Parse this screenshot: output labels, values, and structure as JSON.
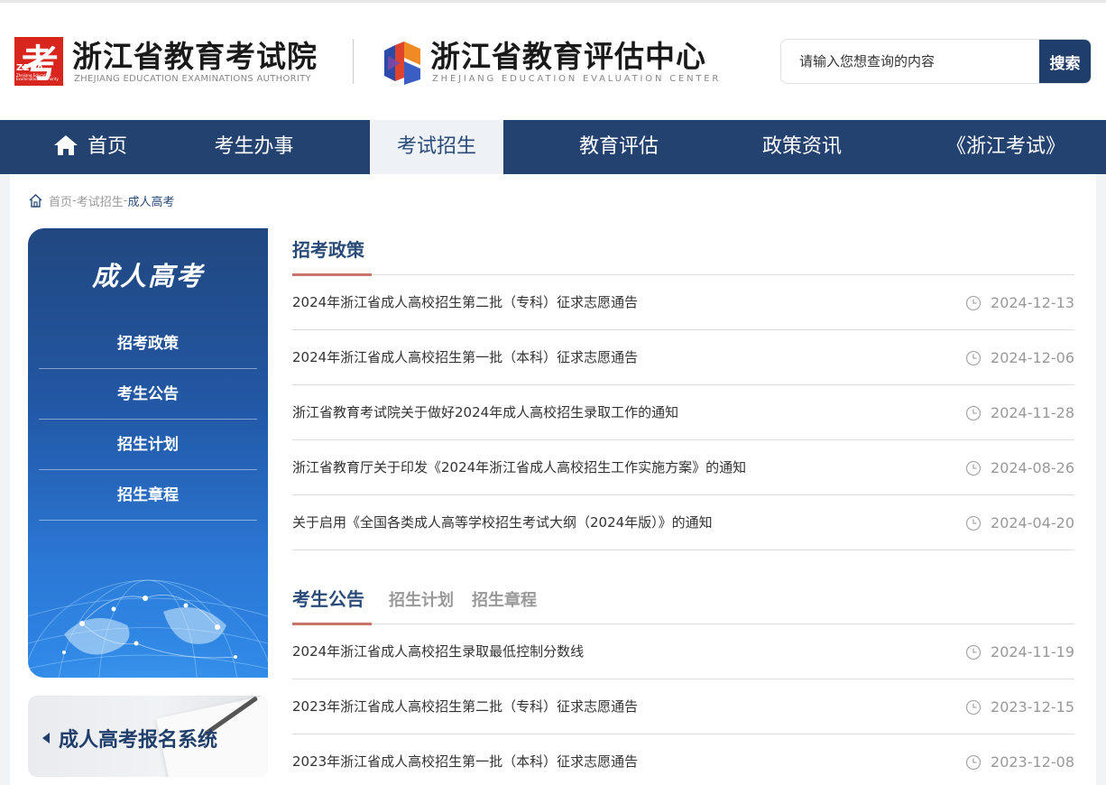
{
  "header": {
    "logo1_glyph": "考",
    "logo1_abbr": "ZEEA",
    "logo1_small": "Zhejiang Education Examinations Authority",
    "title1": "浙江省教育考试院",
    "subtitle1": "ZHEJIANG EDUCATION EXAMINATIONS AUTHORITY",
    "title2": "浙江省教育评估中心",
    "subtitle2": "ZHEJIANG EDUCATION EVALUATION CENTER"
  },
  "search": {
    "placeholder": "请输入您想查询的内容",
    "button_label": "搜索"
  },
  "nav": {
    "items": [
      {
        "label": "首页"
      },
      {
        "label": "考生办事"
      },
      {
        "label": "考试招生"
      },
      {
        "label": "教育评估"
      },
      {
        "label": "政策资讯"
      },
      {
        "label": "《浙江考试》"
      }
    ]
  },
  "breadcrumb": {
    "home": "首页",
    "sep1": "-",
    "level1": "考试招生",
    "sep2": "-",
    "current": "成人高考"
  },
  "sidebar": {
    "title": "成人高考",
    "items": [
      {
        "label": "招考政策"
      },
      {
        "label": "考生公告"
      },
      {
        "label": "招生计划"
      },
      {
        "label": "招生章程"
      }
    ]
  },
  "banner": {
    "label": "成人高考报名系统"
  },
  "section1": {
    "title": "招考政策",
    "items": [
      {
        "title": "2024年浙江省成人高校招生第二批（专科）征求志愿通告",
        "date": "2024-12-13"
      },
      {
        "title": "2024年浙江省成人高校招生第一批（本科）征求志愿通告",
        "date": "2024-12-06"
      },
      {
        "title": "浙江省教育考试院关于做好2024年成人高校招生录取工作的通知",
        "date": "2024-11-28"
      },
      {
        "title": "浙江省教育厅关于印发《2024年浙江省成人高校招生工作实施方案》的通知",
        "date": "2024-08-26"
      },
      {
        "title": "关于启用《全国各类成人高等学校招生考试大纲（2024年版）》的通知",
        "date": "2024-04-20"
      }
    ]
  },
  "section2": {
    "tabs": [
      {
        "label": "考生公告"
      },
      {
        "label": "招生计划"
      },
      {
        "label": "招生章程"
      }
    ],
    "items": [
      {
        "title": "2024年浙江省成人高校招生录取最低控制分数线",
        "date": "2024-11-19"
      },
      {
        "title": "2023年浙江省成人高校招生第二批（专科）征求志愿通告",
        "date": "2023-12-15"
      },
      {
        "title": "2023年浙江省成人高校招生第一批（本科）征求志愿通告",
        "date": "2023-12-08"
      }
    ]
  },
  "colors": {
    "nav_bg": "#244270",
    "accent": "#2a4a78",
    "tab_underline": "#c9746d",
    "logo_red": "#d8261e"
  }
}
